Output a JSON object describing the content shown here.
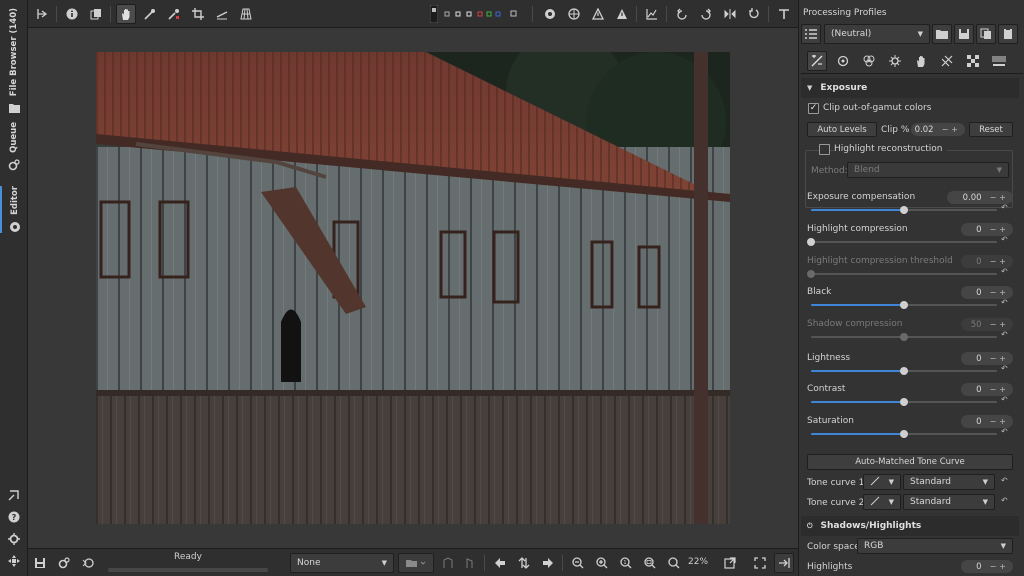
{
  "left_tabs": {
    "file_browser": "File Browser (140)",
    "queue": "Queue",
    "editor": "Editor"
  },
  "status": {
    "ready": "Ready",
    "profile_select": "None",
    "zoom": "22%"
  },
  "right_panel": {
    "profiles_title": "Processing Profiles",
    "profile_value": "(Neutral)"
  },
  "exposure": {
    "title": "Exposure",
    "clip_gamut_label": "Clip out-of-gamut colors",
    "auto_levels": "Auto Levels",
    "clip_pct_label": "Clip %",
    "clip_pct_value": "0.02",
    "reset": "Reset",
    "highlight_recon_label": "Highlight reconstruction",
    "method_label": "Method:",
    "method_value": "Blend",
    "sliders": [
      {
        "label": "Exposure compensation",
        "value": "0.00",
        "fraction": 0.5,
        "enabled": true
      },
      {
        "label": "Highlight compression",
        "value": "0",
        "fraction": 0.0,
        "enabled": true
      },
      {
        "label": "Highlight compression threshold",
        "value": "0",
        "fraction": 0.0,
        "enabled": false
      },
      {
        "label": "Black",
        "value": "0",
        "fraction": 0.5,
        "enabled": true
      },
      {
        "label": "Shadow compression",
        "value": "50",
        "fraction": 0.5,
        "enabled": false
      },
      {
        "label": "Lightness",
        "value": "0",
        "fraction": 0.5,
        "enabled": true
      },
      {
        "label": "Contrast",
        "value": "0",
        "fraction": 0.5,
        "enabled": true
      },
      {
        "label": "Saturation",
        "value": "0",
        "fraction": 0.5,
        "enabled": true
      }
    ],
    "auto_tone_curve": "Auto-Matched Tone Curve",
    "tone_curve_1_label": "Tone curve 1:",
    "tone_curve_1_value": "Standard",
    "tone_curve_2_label": "Tone curve 2:",
    "tone_curve_2_value": "Standard"
  },
  "shadows_highlights": {
    "title": "Shadows/Highlights",
    "color_space_label": "Color space:",
    "color_space_value": "RGB",
    "highlights_label": "Highlights",
    "highlights_value": "0"
  },
  "colors": {
    "accent": "#3f86d8",
    "panel": "#333333",
    "canvas": "#383838"
  }
}
